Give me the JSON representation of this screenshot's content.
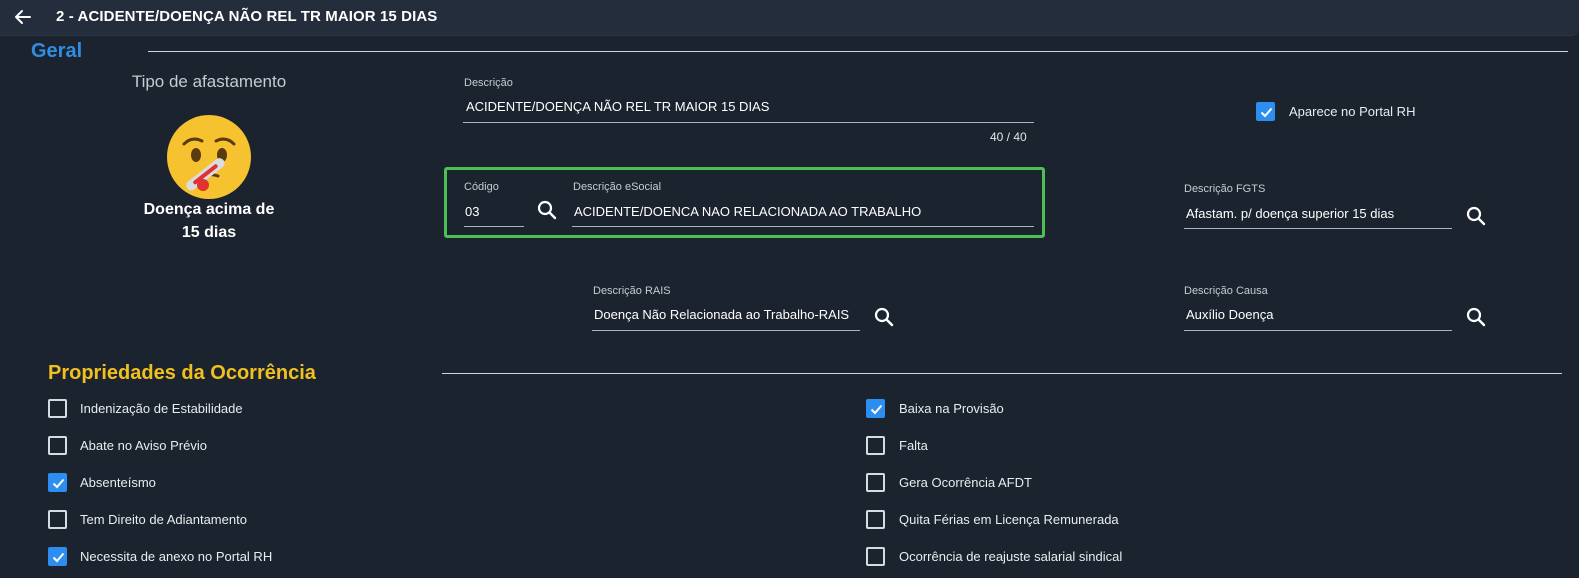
{
  "header": {
    "title": "2 - ACIDENTE/DOENÇA NÃO REL TR MAIOR 15 DIAS",
    "back_icon": "arrow-left-icon"
  },
  "geral": {
    "section_title": "Geral",
    "tipo_afastamento_label": "Tipo de afastamento",
    "tipo_afastamento_icon": "sick-face-thermometer-icon",
    "tipo_afastamento_name_line1": "Doença acima de",
    "tipo_afastamento_name_line2": "15 dias",
    "descricao": {
      "label": "Descrição",
      "value": "ACIDENTE/DOENÇA NÃO REL TR MAIOR 15 DIAS",
      "counter": "40 / 40"
    },
    "aparece_portal": {
      "label": "Aparece no Portal RH",
      "checked": true
    },
    "codigo": {
      "label": "Código",
      "value": "03"
    },
    "descricao_esocial": {
      "label": "Descrição eSocial",
      "value": "ACIDENTE/DOENCA NAO RELACIONADA AO TRABALHO"
    },
    "descricao_fgts": {
      "label": "Descrição FGTS",
      "value": "Afastam. p/ doença superior 15 dias"
    },
    "descricao_rais": {
      "label": "Descrição RAIS",
      "value": "Doença Não Relacionada ao Trabalho-RAIS"
    },
    "descricao_causa": {
      "label": "Descrição Causa",
      "value": "Auxílio Doença"
    }
  },
  "propriedades": {
    "section_title": "Propriedades da Ocorrência",
    "left": [
      {
        "label": "Indenização de Estabilidade",
        "checked": false
      },
      {
        "label": "Abate no Aviso Prévio",
        "checked": false
      },
      {
        "label": "Absenteísmo",
        "checked": true
      },
      {
        "label": "Tem Direito de Adiantamento",
        "checked": false
      },
      {
        "label": "Necessita de anexo no Portal RH",
        "checked": true
      }
    ],
    "right": [
      {
        "label": "Baixa na Provisão",
        "checked": true
      },
      {
        "label": "Falta",
        "checked": false
      },
      {
        "label": "Gera Ocorrência AFDT",
        "checked": false
      },
      {
        "label": "Quita Férias em Licença Remunerada",
        "checked": false
      },
      {
        "label": "Ocorrência de reajuste salarial sindical",
        "checked": false
      }
    ]
  },
  "colors": {
    "background": "#1b232e",
    "topbar": "#232d3b",
    "geral_title": "#2f8de4",
    "prop_title": "#f2c01e",
    "checkbox_checked": "#2b8ef0",
    "highlight": "#4cc153"
  }
}
